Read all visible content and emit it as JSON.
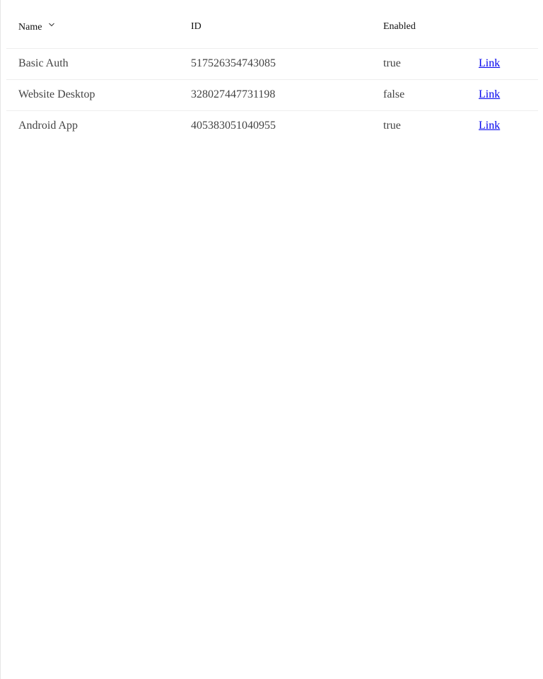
{
  "table": {
    "columns": {
      "name": "Name",
      "id": "ID",
      "enabled": "Enabled"
    },
    "sort_icon": "chevron-down-icon",
    "rows": [
      {
        "name": "Basic Auth",
        "id": "517526354743085",
        "enabled": "true",
        "link": "Link"
      },
      {
        "name": "Website Desktop",
        "id": "328027447731198",
        "enabled": "false",
        "link": "Link"
      },
      {
        "name": "Android App",
        "id": "405383051040955",
        "enabled": "true",
        "link": "Link"
      }
    ]
  }
}
